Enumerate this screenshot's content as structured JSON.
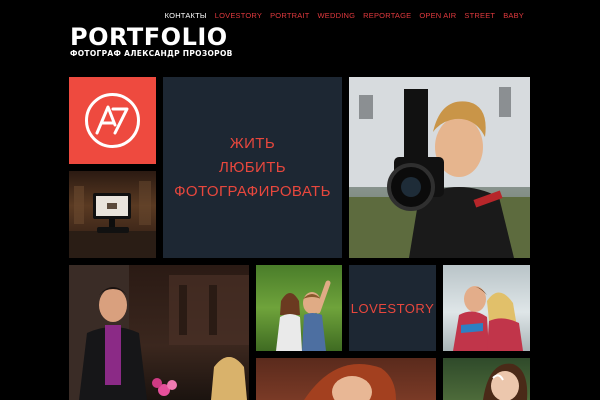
{
  "nav": {
    "items": [
      {
        "label": "КОНТАКТЫ",
        "active": true
      },
      {
        "label": "LOVESTORY"
      },
      {
        "label": "PORTRAIT"
      },
      {
        "label": "WEDDING"
      },
      {
        "label": "REPORTAGE"
      },
      {
        "label": "OPEN AIR"
      },
      {
        "label": "STREET"
      },
      {
        "label": "BABY"
      }
    ]
  },
  "logo": {
    "title": "PORTFOLIO",
    "subtitle": "ФОТОГРАФ АЛЕКСАНДР ПРОЗОРОВ"
  },
  "tiles": {
    "quote": {
      "line1": "ЖИТЬ",
      "line2": "ЛЮБИТЬ",
      "line3": "ФОТОГРАФИРОВАТЬ"
    },
    "lovestory": "LOVESTORY"
  },
  "colors": {
    "background": "#000000",
    "accent": "#e8473d",
    "navy": "#1d2733",
    "active_nav": "#ffffff"
  }
}
